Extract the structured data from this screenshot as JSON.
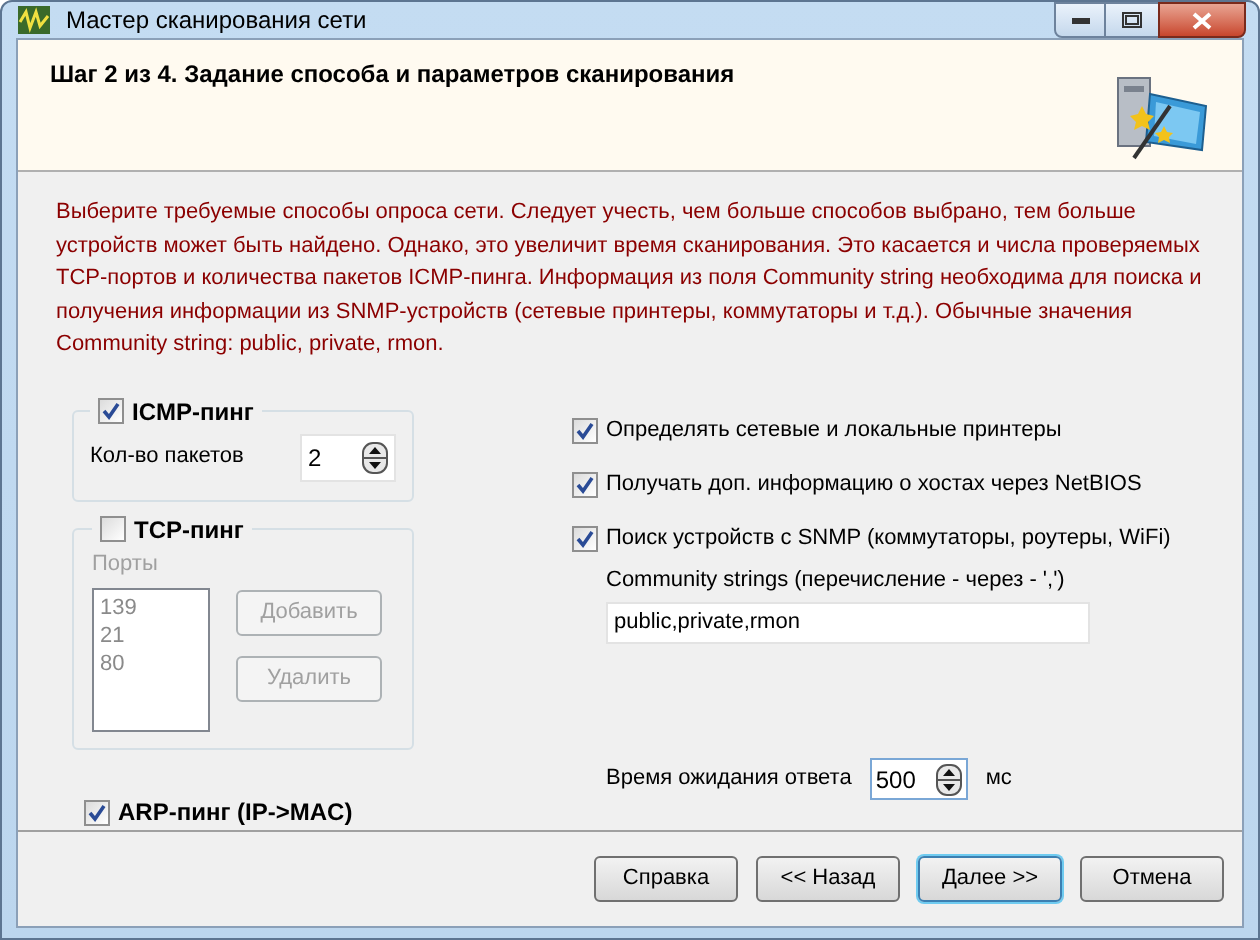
{
  "window": {
    "title": "Мастер сканирования сети"
  },
  "header": {
    "title": "Шаг 2 из 4. Задание способа и параметров сканирования"
  },
  "description": "Выберите требуемые способы опроса сети. Следует учесть, чем больше способов выбрано, тем больше устройств может быть найдено. Однако, это увеличит время сканирования. Это касается и числа проверяемых TCP-портов и количества пакетов ICMP-пинга. Информация из поля Community string необходима для поиска и получения информации из SNMP-устройств (сетевые принтеры, коммутаторы и т.д.). Обычные значения Community string: public, private, rmon.",
  "icmp": {
    "label": "ICMP-пинг",
    "checked": true,
    "packets_label": "Кол-во пакетов",
    "packets_value": "2"
  },
  "tcp": {
    "label": "TCP-пинг",
    "checked": false,
    "ports_label": "Порты",
    "ports": [
      "139",
      "21",
      "80"
    ],
    "buttons": [
      "Добавить",
      "Удалить"
    ]
  },
  "arp": {
    "label": "ARP-пинг (IP->MAC)",
    "checked": true
  },
  "options": [
    {
      "label": "Определять сетевые и локальные принтеры",
      "checked": true
    },
    {
      "label": "Получать доп. информацию о хостах через NetBIOS",
      "checked": true
    },
    {
      "label": "Поиск устройств с SNMP (коммутаторы, роутеры, WiFi)",
      "checked": true
    }
  ],
  "community": {
    "label": "Community strings (перечисление - через - ',')",
    "value": "public,private,rmon"
  },
  "timeout": {
    "label": "Время ожидания ответа",
    "value": "500",
    "unit": "мс"
  },
  "buttons": [
    {
      "label": "Справка",
      "default": false
    },
    {
      "label": "<< Назад",
      "default": false
    },
    {
      "label": "Далее >>",
      "default": true
    },
    {
      "label": "Отмена",
      "default": false
    }
  ]
}
